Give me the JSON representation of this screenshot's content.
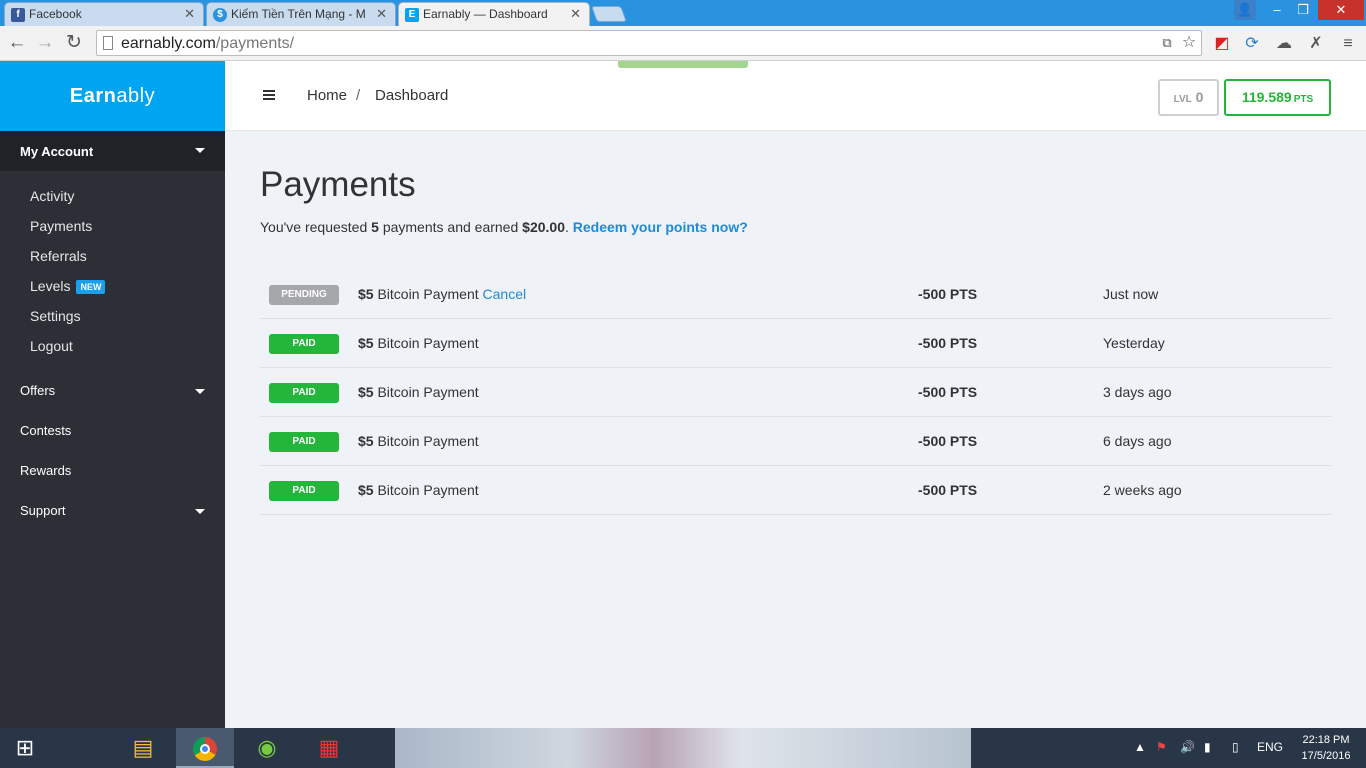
{
  "browser": {
    "tabs": [
      {
        "title": "Facebook",
        "fav": "f",
        "fav_color": "#3b5998"
      },
      {
        "title": "Kiếm Tiền Trên Mạng - M",
        "fav": "$",
        "fav_color": "#2a93e0"
      },
      {
        "title": "Earnably — Dashboard",
        "fav": "E",
        "fav_color": "#00a5f2"
      }
    ],
    "url_host": "earnably.com",
    "url_path": "/payments/"
  },
  "sidebar": {
    "brand_a": "Earn",
    "brand_b": "ably",
    "my_account": "My Account",
    "items": [
      "Activity",
      "Payments",
      "Referrals",
      "Levels",
      "Settings",
      "Logout"
    ],
    "new_badge": "NEW",
    "sections": [
      "Offers",
      "Contests",
      "Rewards",
      "Support"
    ]
  },
  "topbar": {
    "crumb_home": "Home",
    "crumb_sep": "/",
    "crumb_current": "Dashboard",
    "level_label": "LVL",
    "level_value": "0",
    "points_value": "119.589",
    "points_unit": "PTS"
  },
  "main": {
    "title": "Payments",
    "summary_pre": "You've requested ",
    "summary_count": "5",
    "summary_mid": " payments and earned ",
    "summary_amount": "$20.00",
    "summary_end": ". ",
    "redeem_link": "Redeem your points now?",
    "cancel_label": "Cancel",
    "rows": [
      {
        "status": "PENDING",
        "amount": "$5",
        "desc": " Bitcoin Payment",
        "points": "-500 PTS",
        "when": "Just now"
      },
      {
        "status": "PAID",
        "amount": "$5",
        "desc": " Bitcoin Payment",
        "points": "-500 PTS",
        "when": "Yesterday"
      },
      {
        "status": "PAID",
        "amount": "$5",
        "desc": " Bitcoin Payment",
        "points": "-500 PTS",
        "when": "3 days ago"
      },
      {
        "status": "PAID",
        "amount": "$5",
        "desc": " Bitcoin Payment",
        "points": "-500 PTS",
        "when": "6 days ago"
      },
      {
        "status": "PAID",
        "amount": "$5",
        "desc": " Bitcoin Payment",
        "points": "-500 PTS",
        "when": "2 weeks ago"
      }
    ]
  },
  "taskbar": {
    "lang": "ENG",
    "time": "22:18 PM",
    "date": "17/5/2016"
  },
  "colors": {
    "brand": "#00a5f2",
    "paid": "#24b53b",
    "pending": "#a5a7aa",
    "link": "#1f8ad6"
  }
}
